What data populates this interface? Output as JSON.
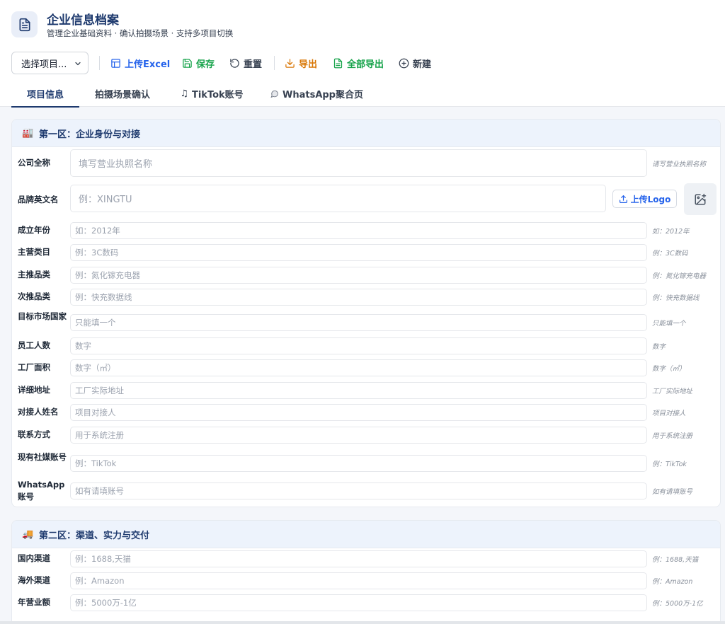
{
  "header": {
    "title": "企业信息档案",
    "subtitle": "管理企业基础资料 · 确认拍摄场景 · 支持多项目切换",
    "icon": "document-icon"
  },
  "toolbar": {
    "project_select": "选择项目...",
    "upload_excel": "上传Excel",
    "save": "保存",
    "reset": "重置",
    "export": "导出",
    "export_all": "全部导出",
    "new": "新建"
  },
  "tabs": [
    {
      "label": "项目信息",
      "active": true
    },
    {
      "label": "拍摄场景确认",
      "active": false
    },
    {
      "label": "TikTok账号",
      "icon": "music-note-icon",
      "active": false
    },
    {
      "label": "WhatsApp聚合页",
      "icon": "speech-bubble-icon",
      "active": false
    }
  ],
  "section1": {
    "emoji": "🏭",
    "title": "第一区：企业身份与对接",
    "upload_logo": "上传Logo",
    "fields": [
      {
        "label": "公司全称",
        "placeholder": "填写营业执照名称",
        "hint": "请写营业执照名称"
      },
      {
        "label": "品牌英文名",
        "placeholder": "例：XINGTU",
        "hint": ""
      },
      {
        "label": "成立年份",
        "placeholder": "如：2012年",
        "hint": "如：2012年"
      },
      {
        "label": "主营类目",
        "placeholder": "例：3C数码",
        "hint": "例：3C数码"
      },
      {
        "label": "主推品类",
        "placeholder": "例：氮化镓充电器",
        "hint": "例：氮化镓充电器"
      },
      {
        "label": "次推品类",
        "placeholder": "例：快充数据线",
        "hint": "例：快充数据线"
      },
      {
        "label": "目标市场国家",
        "placeholder": "只能填一个",
        "hint": "只能填一个"
      },
      {
        "label": "员工人数",
        "placeholder": "数字",
        "hint": "数字"
      },
      {
        "label": "工厂面积",
        "placeholder": "数字（㎡）",
        "hint": "数字（㎡）"
      },
      {
        "label": "详细地址",
        "placeholder": "工厂实际地址",
        "hint": "工厂实际地址"
      },
      {
        "label": "对接人姓名",
        "placeholder": "项目对接人",
        "hint": "项目对接人"
      },
      {
        "label": "联系方式",
        "placeholder": "用于系统注册",
        "hint": "用于系统注册"
      },
      {
        "label": "现有社媒账号",
        "placeholder": "例：TikTok",
        "hint": "例：TikTok"
      },
      {
        "label": "WhatsApp账号",
        "placeholder": "如有请填账号",
        "hint": "如有请填账号"
      }
    ]
  },
  "section2": {
    "emoji": "🚚",
    "title": "第二区：渠道、实力与交付",
    "fields": [
      {
        "label": "国内渠道",
        "placeholder": "例：1688,天猫",
        "hint": "例：1688,天猫"
      },
      {
        "label": "海外渠道",
        "placeholder": "例：Amazon",
        "hint": "例：Amazon"
      },
      {
        "label": "年营业额",
        "placeholder": "例：5000万-1亿",
        "hint": "例：5000万-1亿"
      }
    ]
  },
  "colors": {
    "primary": "#1e3a6e",
    "link": "#2563eb",
    "success": "#16a34a",
    "warning": "#d97706"
  }
}
